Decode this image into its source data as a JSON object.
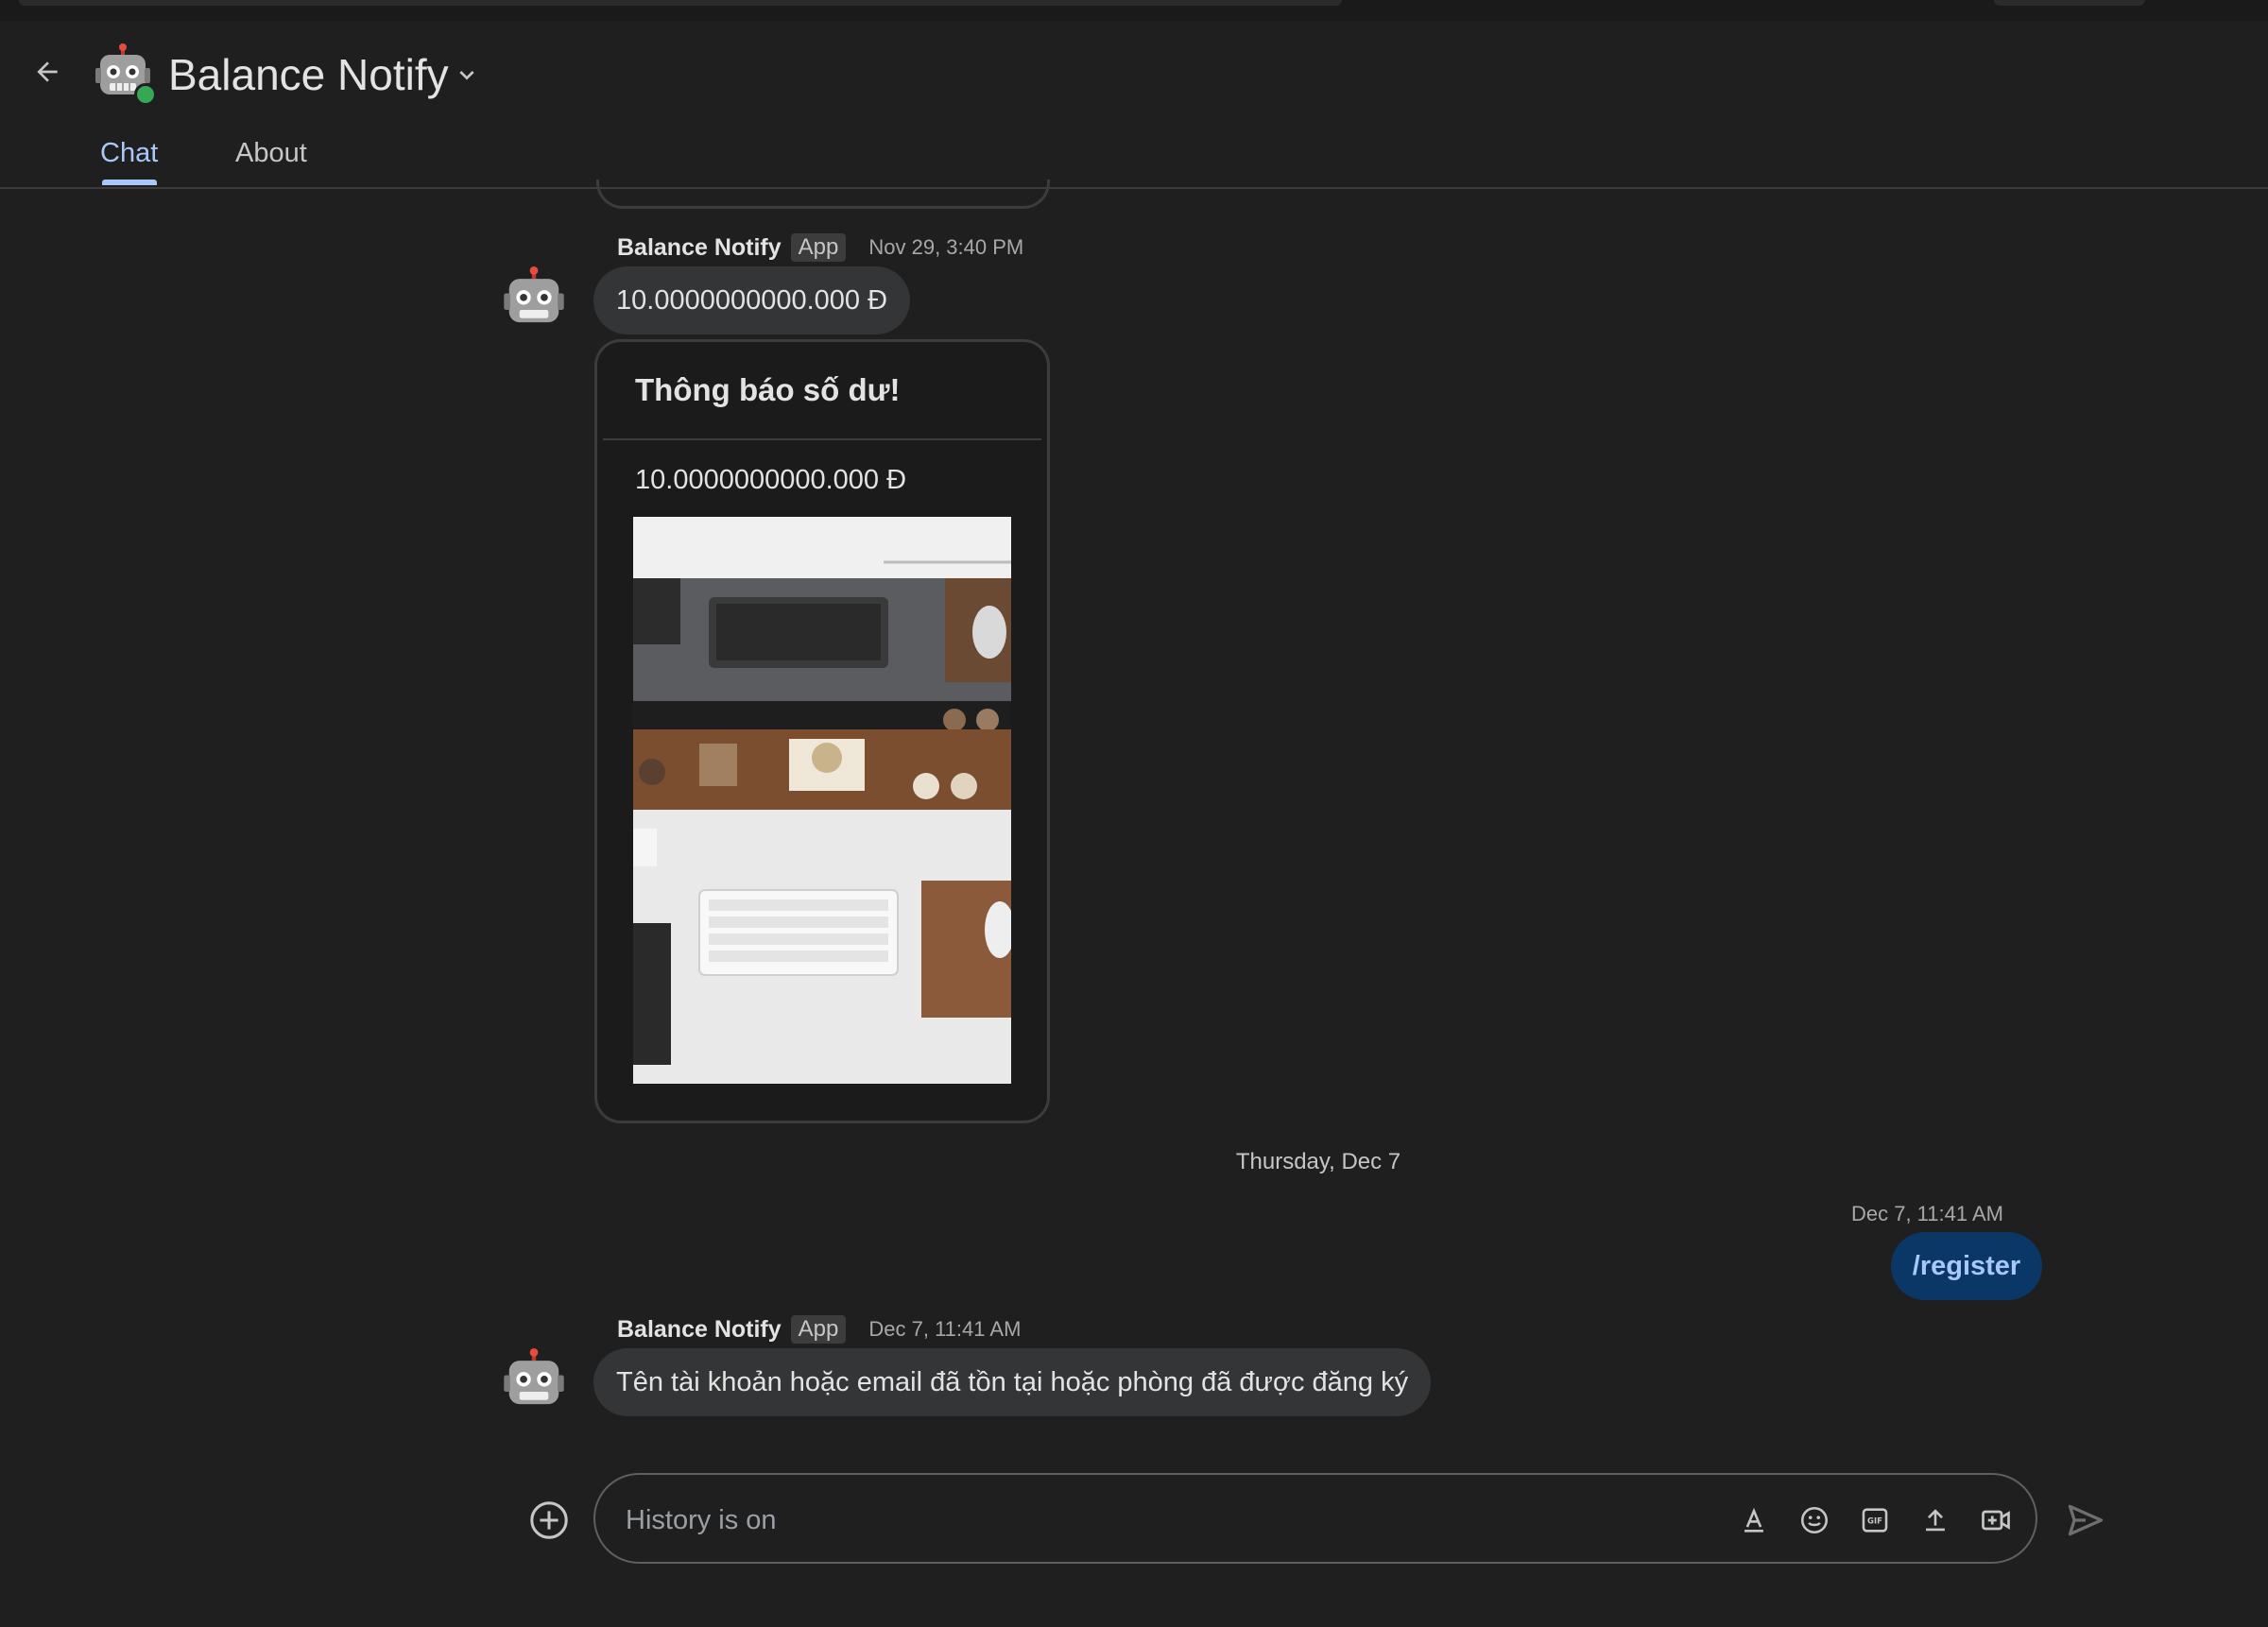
{
  "header": {
    "title": "Balance Notify",
    "tabs": [
      {
        "label": "Chat",
        "active": true
      },
      {
        "label": "About",
        "active": false
      }
    ]
  },
  "messages": [
    {
      "sender": "Balance Notify",
      "badge": "App",
      "time": "Nov 29, 3:40 PM",
      "text": "10.0000000000.000 Đ",
      "card": {
        "title": "Thông báo số dư!",
        "amount": "10.0000000000.000 Đ"
      }
    },
    {
      "sender": "Balance Notify",
      "badge": "App",
      "time": "Dec 7, 11:41 AM",
      "text": "Tên tài khoản hoặc email đã tồn tại hoặc phòng đã được đăng ký"
    }
  ],
  "date_separator": "Thursday, Dec 7",
  "my_message": {
    "time": "Dec 7, 11:41 AM",
    "text": "/register"
  },
  "composer": {
    "placeholder": "History is on"
  },
  "colors": {
    "background": "#1f1f1f",
    "accent": "#a8c7fa",
    "bubble": "#333537",
    "my_bubble": "#0b3767",
    "online": "#34a853"
  }
}
